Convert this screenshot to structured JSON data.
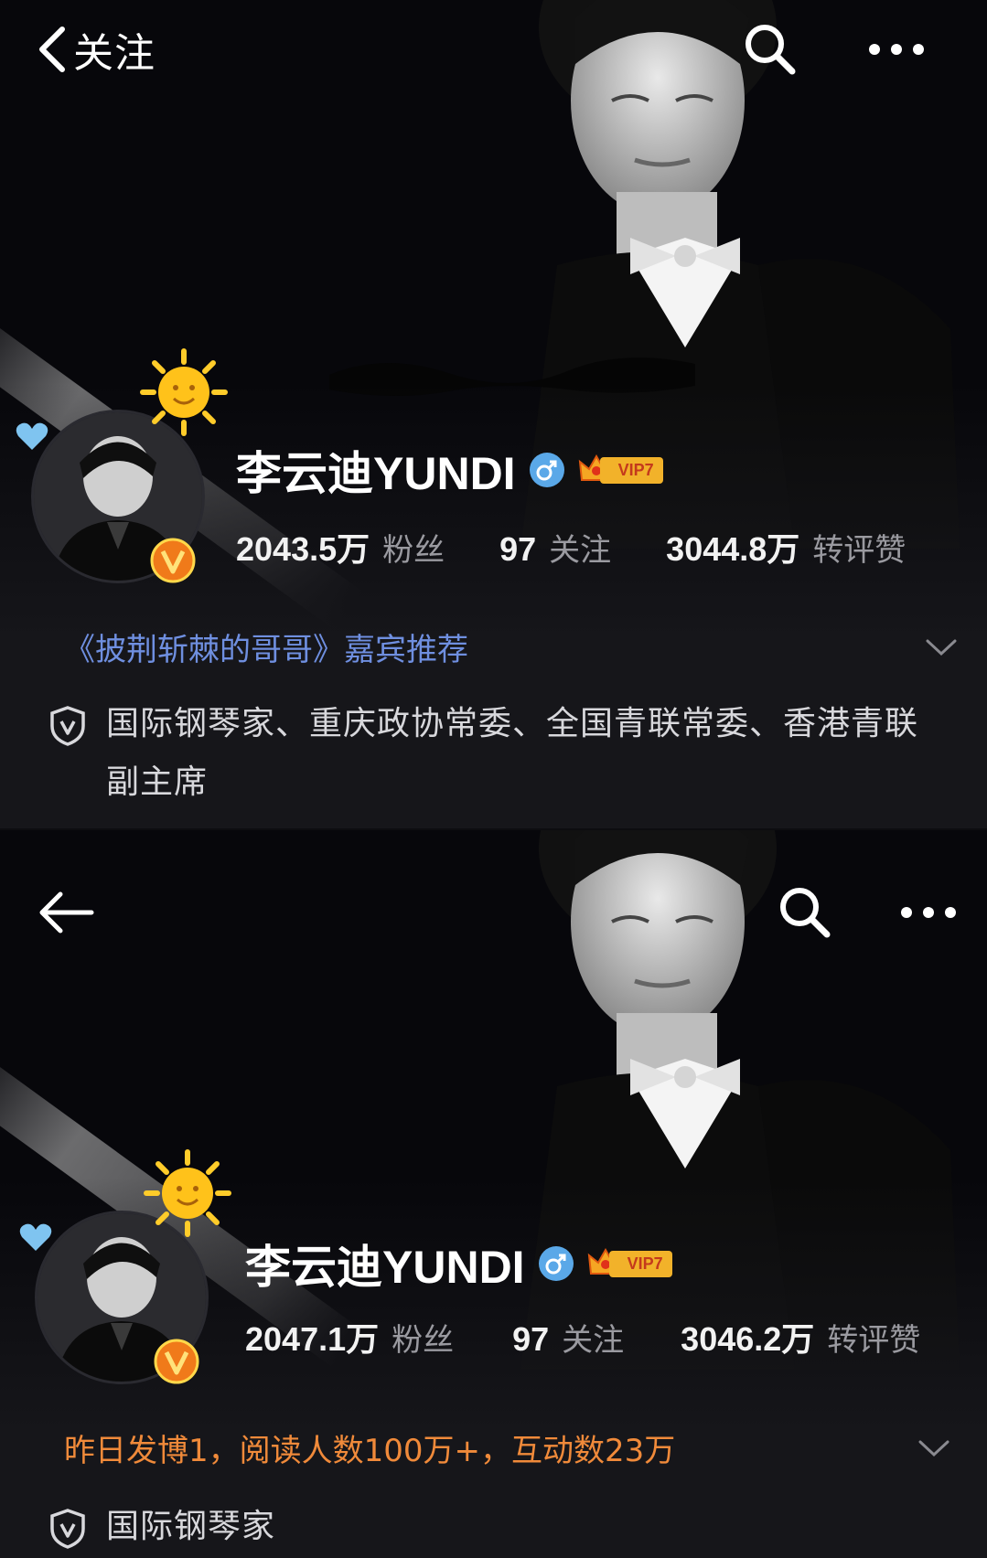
{
  "panels": [
    {
      "back_label": "关注",
      "profile": {
        "name": "李云迪YUNDI",
        "vip": "VIP7",
        "stats": [
          {
            "value": "2043.5万",
            "label": "粉丝"
          },
          {
            "value": "97",
            "label": "关注"
          },
          {
            "value": "3044.8万",
            "label": "转评赞"
          }
        ]
      },
      "promo_text": "《披荆斩棘的哥哥》嘉宾推荐",
      "verification": "国际钢琴家、重庆政协常委、全国青联常委、香港青联副主席"
    },
    {
      "back_label": "",
      "profile": {
        "name": "李云迪YUNDI",
        "vip": "VIP7",
        "stats": [
          {
            "value": "2047.1万",
            "label": "粉丝"
          },
          {
            "value": "97",
            "label": "关注"
          },
          {
            "value": "3046.2万",
            "label": "转评赞"
          }
        ]
      },
      "promo_text": "昨日发博1，阅读人数100万+，互动数23万",
      "verification": "国际钢琴家"
    }
  ],
  "colors": {
    "background": "#16161a",
    "promo_blue": "#6f8fe0",
    "promo_orange": "#f08a3a",
    "verified_orange": "#f07a1a",
    "gender_blue": "#5aa8e8",
    "vip_gold": "#f2b22a"
  },
  "icons": [
    "back-chevron-icon",
    "back-arrow-icon",
    "search-icon",
    "more-icon",
    "verified-v-icon",
    "sun-badge-icon",
    "heart-badge-icon",
    "male-icon",
    "vip-crown-icon",
    "chevron-down-icon",
    "shield-v-icon"
  ]
}
